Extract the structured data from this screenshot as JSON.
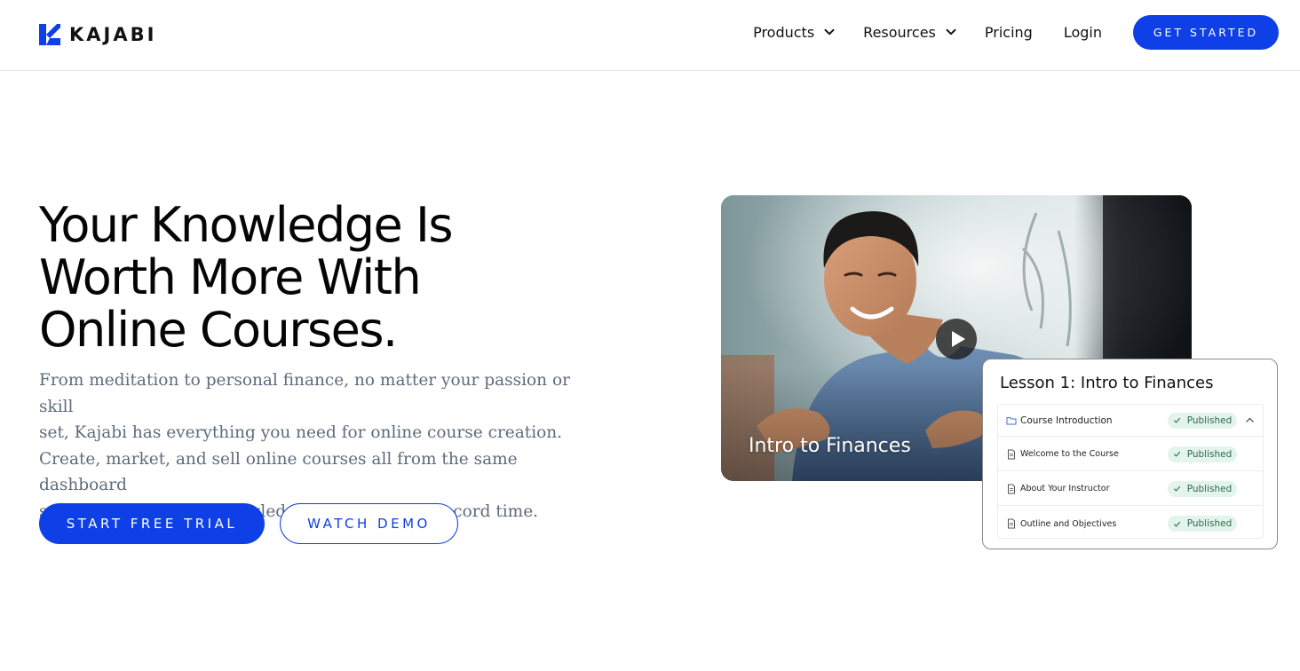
{
  "brand": {
    "name": "KAJABI",
    "color": "#0f3fe6"
  },
  "nav": {
    "items": [
      {
        "label": "Products",
        "has_dropdown": true
      },
      {
        "label": "Resources",
        "has_dropdown": true
      },
      {
        "label": "Pricing",
        "has_dropdown": false
      },
      {
        "label": "Login",
        "has_dropdown": false
      }
    ],
    "cta_label": "GET STARTED"
  },
  "hero": {
    "title_lines": [
      "Your Knowledge Is",
      "Worth More With",
      "Online Courses."
    ],
    "subtitle_lines": [
      "From meditation to personal finance, no matter your passion or skill",
      "set, Kajabi has everything you need for online course creation.",
      "Create, market, and sell online courses all from the same dashboard",
      "so you can turn your knowledge into income in record time."
    ],
    "primary_cta": "START FREE TRIAL",
    "secondary_cta": "WATCH DEMO"
  },
  "video": {
    "title": "Intro to Finances",
    "play_icon": "play-icon"
  },
  "lesson_panel": {
    "title": "Lesson 1: Intro to Finances",
    "rows": [
      {
        "label": "Course Introduction",
        "icon": "folder-icon",
        "status": "Published"
      },
      {
        "label": "Welcome to the Course",
        "icon": "document-icon",
        "status": "Published"
      },
      {
        "label": "About Your Instructor",
        "icon": "document-icon",
        "status": "Published"
      },
      {
        "label": "Outline and Objectives",
        "icon": "document-icon",
        "status": "Published"
      }
    ],
    "status_color": "#2d6a4f",
    "status_bg": "#e3f4ec"
  }
}
